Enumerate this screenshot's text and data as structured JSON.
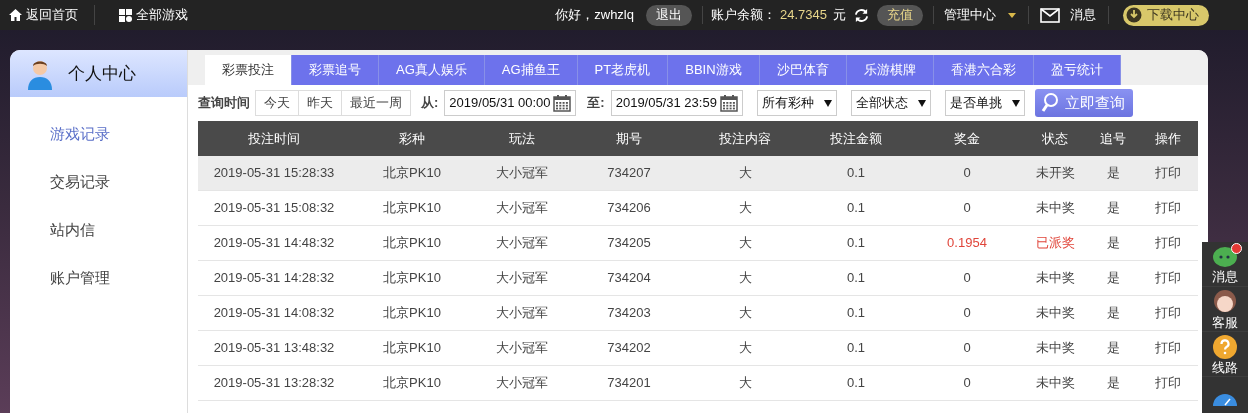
{
  "top_bar": {
    "home": "返回首页",
    "all_games": "全部游戏",
    "greeting": "你好，zwhzlq",
    "logout": "退出",
    "balance_label": "账户余额：",
    "balance": "24.7345",
    "currency": "元",
    "recharge": "充值",
    "manage": "管理中心",
    "messages": "消息",
    "download": "下载中心"
  },
  "sidebar": {
    "title": "个人中心",
    "items": [
      {
        "label": "游戏记录",
        "selected": true
      },
      {
        "label": "交易记录",
        "selected": false
      },
      {
        "label": "站内信",
        "selected": false
      },
      {
        "label": "账户管理",
        "selected": false
      }
    ]
  },
  "tabs": [
    {
      "label": "彩票投注",
      "selected": true
    },
    {
      "label": "彩票追号",
      "selected": false
    },
    {
      "label": "AG真人娱乐",
      "selected": false
    },
    {
      "label": "AG捕鱼王",
      "selected": false
    },
    {
      "label": "PT老虎机",
      "selected": false
    },
    {
      "label": "BBIN游戏",
      "selected": false
    },
    {
      "label": "沙巴体育",
      "selected": false
    },
    {
      "label": "乐游棋牌",
      "selected": false
    },
    {
      "label": "香港六合彩",
      "selected": false
    },
    {
      "label": "盈亏统计",
      "selected": false
    }
  ],
  "filters": {
    "query_time_label": "查询时间",
    "quick_ranges": [
      "今天",
      "昨天",
      "最近一周"
    ],
    "from_label": "从:",
    "from_value": "2019/05/31 00:00",
    "to_label": "至:",
    "to_value": "2019/05/31 23:59",
    "selects": [
      "所有彩种",
      "全部状态",
      "是否单挑"
    ],
    "search_button": "立即查询"
  },
  "table": {
    "columns": [
      "投注时间",
      "彩种",
      "玩法",
      "期号",
      "投注内容",
      "投注金额",
      "奖金",
      "状态",
      "追号",
      "操作"
    ],
    "rows": [
      {
        "cells": [
          "2019-05-31 15:28:33",
          "北京PK10",
          "大小冠军",
          "734207",
          "大",
          "0.1",
          "0",
          "未开奖",
          "是",
          "打印"
        ],
        "selected": true,
        "won": false
      },
      {
        "cells": [
          "2019-05-31 15:08:32",
          "北京PK10",
          "大小冠军",
          "734206",
          "大",
          "0.1",
          "0",
          "未中奖",
          "是",
          "打印"
        ],
        "selected": false,
        "won": false
      },
      {
        "cells": [
          "2019-05-31 14:48:32",
          "北京PK10",
          "大小冠军",
          "734205",
          "大",
          "0.1",
          "0.1954",
          "已派奖",
          "是",
          "打印"
        ],
        "selected": false,
        "won": true
      },
      {
        "cells": [
          "2019-05-31 14:28:32",
          "北京PK10",
          "大小冠军",
          "734204",
          "大",
          "0.1",
          "0",
          "未中奖",
          "是",
          "打印"
        ],
        "selected": false,
        "won": false
      },
      {
        "cells": [
          "2019-05-31 14:08:32",
          "北京PK10",
          "大小冠军",
          "734203",
          "大",
          "0.1",
          "0",
          "未中奖",
          "是",
          "打印"
        ],
        "selected": false,
        "won": false
      },
      {
        "cells": [
          "2019-05-31 13:48:32",
          "北京PK10",
          "大小冠军",
          "734202",
          "大",
          "0.1",
          "0",
          "未中奖",
          "是",
          "打印"
        ],
        "selected": false,
        "won": false
      },
      {
        "cells": [
          "2019-05-31 13:28:32",
          "北京PK10",
          "大小冠军",
          "734201",
          "大",
          "0.1",
          "0",
          "未中奖",
          "是",
          "打印"
        ],
        "selected": false,
        "won": false
      }
    ]
  },
  "float_panel": [
    {
      "kind": "chat",
      "label": "消息",
      "badge": true
    },
    {
      "kind": "service",
      "label": "客服",
      "badge": false
    },
    {
      "kind": "help",
      "label": "线路",
      "badge": false
    },
    {
      "kind": "speed",
      "badge": false
    }
  ]
}
